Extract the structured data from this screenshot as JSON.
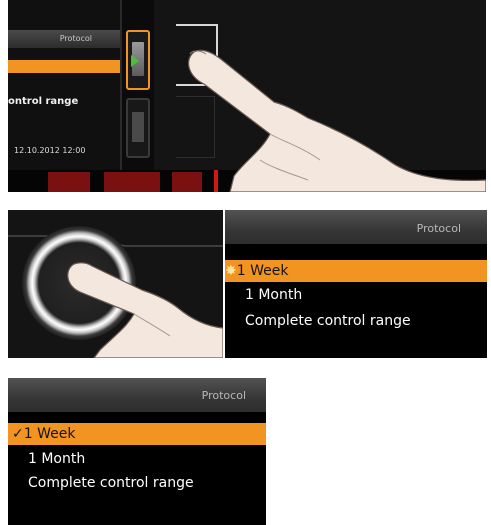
{
  "step1": {
    "header_title": "Protocol",
    "control_range_text": "ontrol range",
    "date_text": "12.10.2012  12:00"
  },
  "step3": {
    "header_title": "Protocol",
    "items": [
      {
        "label": "1 Week",
        "selected": true,
        "marker": "✸"
      },
      {
        "label": "1 Month",
        "selected": false,
        "marker": ""
      },
      {
        "label": "Complete control range",
        "selected": false,
        "marker": ""
      }
    ]
  },
  "step4": {
    "header_title": "Protocol",
    "items": [
      {
        "label": "1 Week",
        "selected": true,
        "marker": "✓"
      },
      {
        "label": "1 Month",
        "selected": false,
        "marker": ""
      },
      {
        "label": "Complete control range",
        "selected": false,
        "marker": ""
      }
    ]
  },
  "icons": {
    "protocol_button": "protocol-doc-arrow-icon",
    "lock_button": "lock-doc-icon",
    "hand": "pointing-hand-icon"
  },
  "colors": {
    "accent": "#f29422",
    "screen_bg": "#000000",
    "header_bg": "#3a3a3a",
    "arrow_green": "#4fbf3a",
    "brand_red": "#d01818"
  }
}
